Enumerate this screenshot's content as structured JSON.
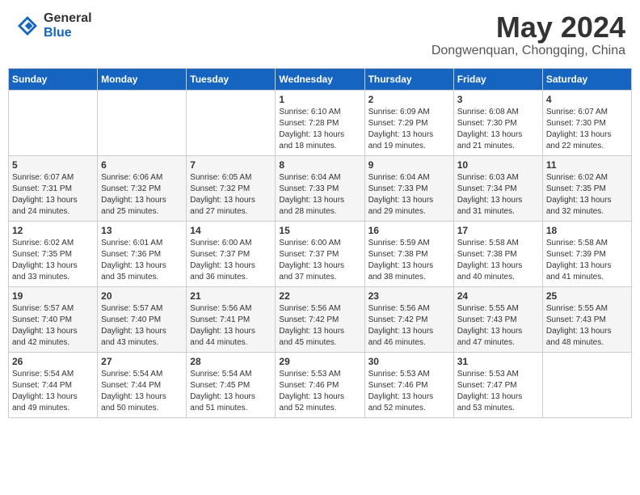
{
  "header": {
    "logo_general": "General",
    "logo_blue": "Blue",
    "month_title": "May 2024",
    "location": "Dongwenquan, Chongqing, China"
  },
  "days_of_week": [
    "Sunday",
    "Monday",
    "Tuesday",
    "Wednesday",
    "Thursday",
    "Friday",
    "Saturday"
  ],
  "weeks": [
    [
      {
        "day": "",
        "info": ""
      },
      {
        "day": "",
        "info": ""
      },
      {
        "day": "",
        "info": ""
      },
      {
        "day": "1",
        "info": "Sunrise: 6:10 AM\nSunset: 7:28 PM\nDaylight: 13 hours\nand 18 minutes."
      },
      {
        "day": "2",
        "info": "Sunrise: 6:09 AM\nSunset: 7:29 PM\nDaylight: 13 hours\nand 19 minutes."
      },
      {
        "day": "3",
        "info": "Sunrise: 6:08 AM\nSunset: 7:30 PM\nDaylight: 13 hours\nand 21 minutes."
      },
      {
        "day": "4",
        "info": "Sunrise: 6:07 AM\nSunset: 7:30 PM\nDaylight: 13 hours\nand 22 minutes."
      }
    ],
    [
      {
        "day": "5",
        "info": "Sunrise: 6:07 AM\nSunset: 7:31 PM\nDaylight: 13 hours\nand 24 minutes."
      },
      {
        "day": "6",
        "info": "Sunrise: 6:06 AM\nSunset: 7:32 PM\nDaylight: 13 hours\nand 25 minutes."
      },
      {
        "day": "7",
        "info": "Sunrise: 6:05 AM\nSunset: 7:32 PM\nDaylight: 13 hours\nand 27 minutes."
      },
      {
        "day": "8",
        "info": "Sunrise: 6:04 AM\nSunset: 7:33 PM\nDaylight: 13 hours\nand 28 minutes."
      },
      {
        "day": "9",
        "info": "Sunrise: 6:04 AM\nSunset: 7:33 PM\nDaylight: 13 hours\nand 29 minutes."
      },
      {
        "day": "10",
        "info": "Sunrise: 6:03 AM\nSunset: 7:34 PM\nDaylight: 13 hours\nand 31 minutes."
      },
      {
        "day": "11",
        "info": "Sunrise: 6:02 AM\nSunset: 7:35 PM\nDaylight: 13 hours\nand 32 minutes."
      }
    ],
    [
      {
        "day": "12",
        "info": "Sunrise: 6:02 AM\nSunset: 7:35 PM\nDaylight: 13 hours\nand 33 minutes."
      },
      {
        "day": "13",
        "info": "Sunrise: 6:01 AM\nSunset: 7:36 PM\nDaylight: 13 hours\nand 35 minutes."
      },
      {
        "day": "14",
        "info": "Sunrise: 6:00 AM\nSunset: 7:37 PM\nDaylight: 13 hours\nand 36 minutes."
      },
      {
        "day": "15",
        "info": "Sunrise: 6:00 AM\nSunset: 7:37 PM\nDaylight: 13 hours\nand 37 minutes."
      },
      {
        "day": "16",
        "info": "Sunrise: 5:59 AM\nSunset: 7:38 PM\nDaylight: 13 hours\nand 38 minutes."
      },
      {
        "day": "17",
        "info": "Sunrise: 5:58 AM\nSunset: 7:38 PM\nDaylight: 13 hours\nand 40 minutes."
      },
      {
        "day": "18",
        "info": "Sunrise: 5:58 AM\nSunset: 7:39 PM\nDaylight: 13 hours\nand 41 minutes."
      }
    ],
    [
      {
        "day": "19",
        "info": "Sunrise: 5:57 AM\nSunset: 7:40 PM\nDaylight: 13 hours\nand 42 minutes."
      },
      {
        "day": "20",
        "info": "Sunrise: 5:57 AM\nSunset: 7:40 PM\nDaylight: 13 hours\nand 43 minutes."
      },
      {
        "day": "21",
        "info": "Sunrise: 5:56 AM\nSunset: 7:41 PM\nDaylight: 13 hours\nand 44 minutes."
      },
      {
        "day": "22",
        "info": "Sunrise: 5:56 AM\nSunset: 7:42 PM\nDaylight: 13 hours\nand 45 minutes."
      },
      {
        "day": "23",
        "info": "Sunrise: 5:56 AM\nSunset: 7:42 PM\nDaylight: 13 hours\nand 46 minutes."
      },
      {
        "day": "24",
        "info": "Sunrise: 5:55 AM\nSunset: 7:43 PM\nDaylight: 13 hours\nand 47 minutes."
      },
      {
        "day": "25",
        "info": "Sunrise: 5:55 AM\nSunset: 7:43 PM\nDaylight: 13 hours\nand 48 minutes."
      }
    ],
    [
      {
        "day": "26",
        "info": "Sunrise: 5:54 AM\nSunset: 7:44 PM\nDaylight: 13 hours\nand 49 minutes."
      },
      {
        "day": "27",
        "info": "Sunrise: 5:54 AM\nSunset: 7:44 PM\nDaylight: 13 hours\nand 50 minutes."
      },
      {
        "day": "28",
        "info": "Sunrise: 5:54 AM\nSunset: 7:45 PM\nDaylight: 13 hours\nand 51 minutes."
      },
      {
        "day": "29",
        "info": "Sunrise: 5:53 AM\nSunset: 7:46 PM\nDaylight: 13 hours\nand 52 minutes."
      },
      {
        "day": "30",
        "info": "Sunrise: 5:53 AM\nSunset: 7:46 PM\nDaylight: 13 hours\nand 52 minutes."
      },
      {
        "day": "31",
        "info": "Sunrise: 5:53 AM\nSunset: 7:47 PM\nDaylight: 13 hours\nand 53 minutes."
      },
      {
        "day": "",
        "info": ""
      }
    ]
  ]
}
